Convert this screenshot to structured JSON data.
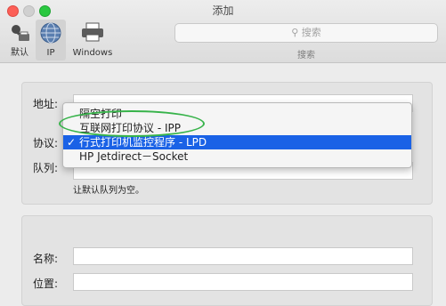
{
  "window": {
    "title": "添加"
  },
  "toolbar": {
    "items": [
      {
        "label": "默认",
        "icon": "default-printers-icon"
      },
      {
        "label": "IP",
        "icon": "ip-globe-icon"
      },
      {
        "label": "Windows",
        "icon": "windows-printer-icon"
      }
    ],
    "search_placeholder": "搜索",
    "search_caption": "搜索"
  },
  "form": {
    "address_label": "地址:",
    "protocol_label": "协议:",
    "queue_label": "队列:",
    "queue_hint": "让默认队列为空。",
    "name_label": "名称:",
    "location_label": "位置:"
  },
  "protocol_menu": {
    "items": [
      "隔空打印",
      "互联网打印协议 - IPP",
      "行式打印机监控程序 - LPD",
      "HP Jetdirect－Socket"
    ],
    "selected_index": 2,
    "check_mark": "✓"
  },
  "colors": {
    "selection": "#1a62e6",
    "annotation_circle": "#37b34a"
  }
}
